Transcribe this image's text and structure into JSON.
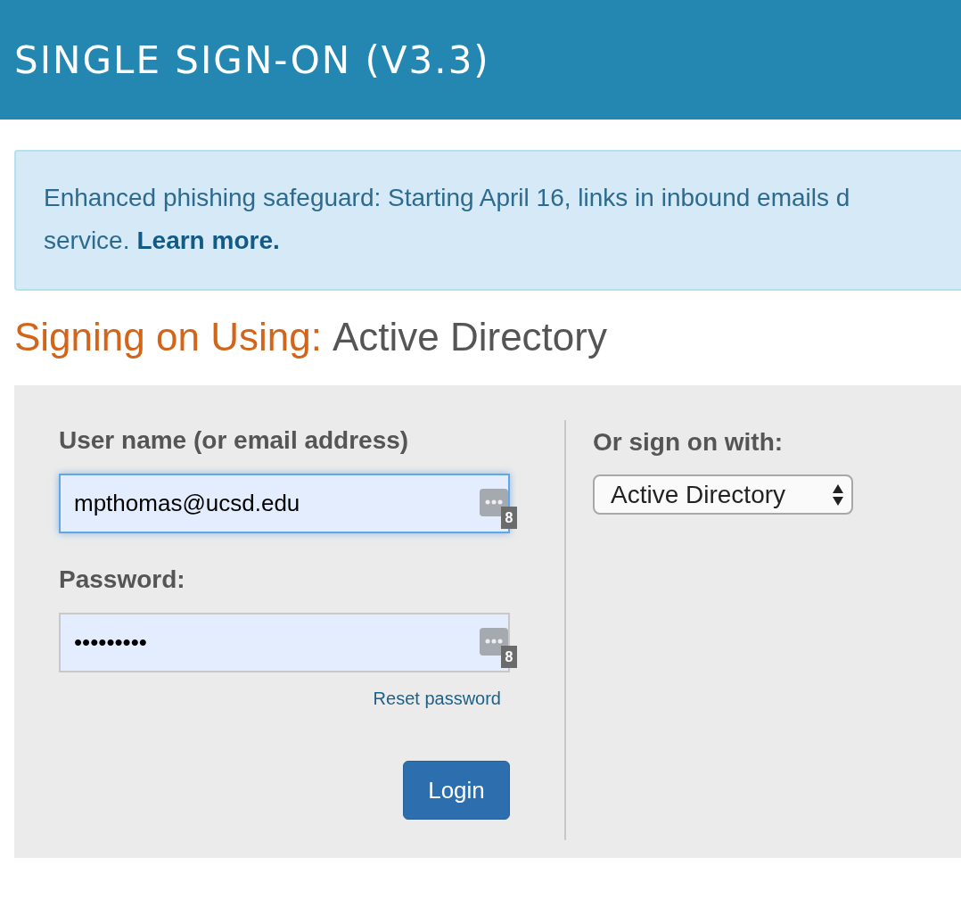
{
  "header": {
    "title": "SINGLE SIGN-ON (V3.3)"
  },
  "notice": {
    "line_1": "Enhanced phishing safeguard: Starting April 16, links in inbound emails d",
    "line_2": "service.",
    "link": "Learn more."
  },
  "heading": {
    "label": "Signing on Using:",
    "value": "Active Directory"
  },
  "form": {
    "fields": [
      {
        "label": "User name (or email address)",
        "value": "mpthomas@ucsd.edu",
        "focused": true,
        "badge": "8"
      },
      {
        "label": "Password:",
        "value": "•••••••••",
        "focused": false,
        "badge": "8"
      }
    ],
    "reset_link": "Reset password",
    "login_button": "Login"
  },
  "alternate": {
    "label": "Or sign on with:",
    "select": "Active Directory"
  }
}
